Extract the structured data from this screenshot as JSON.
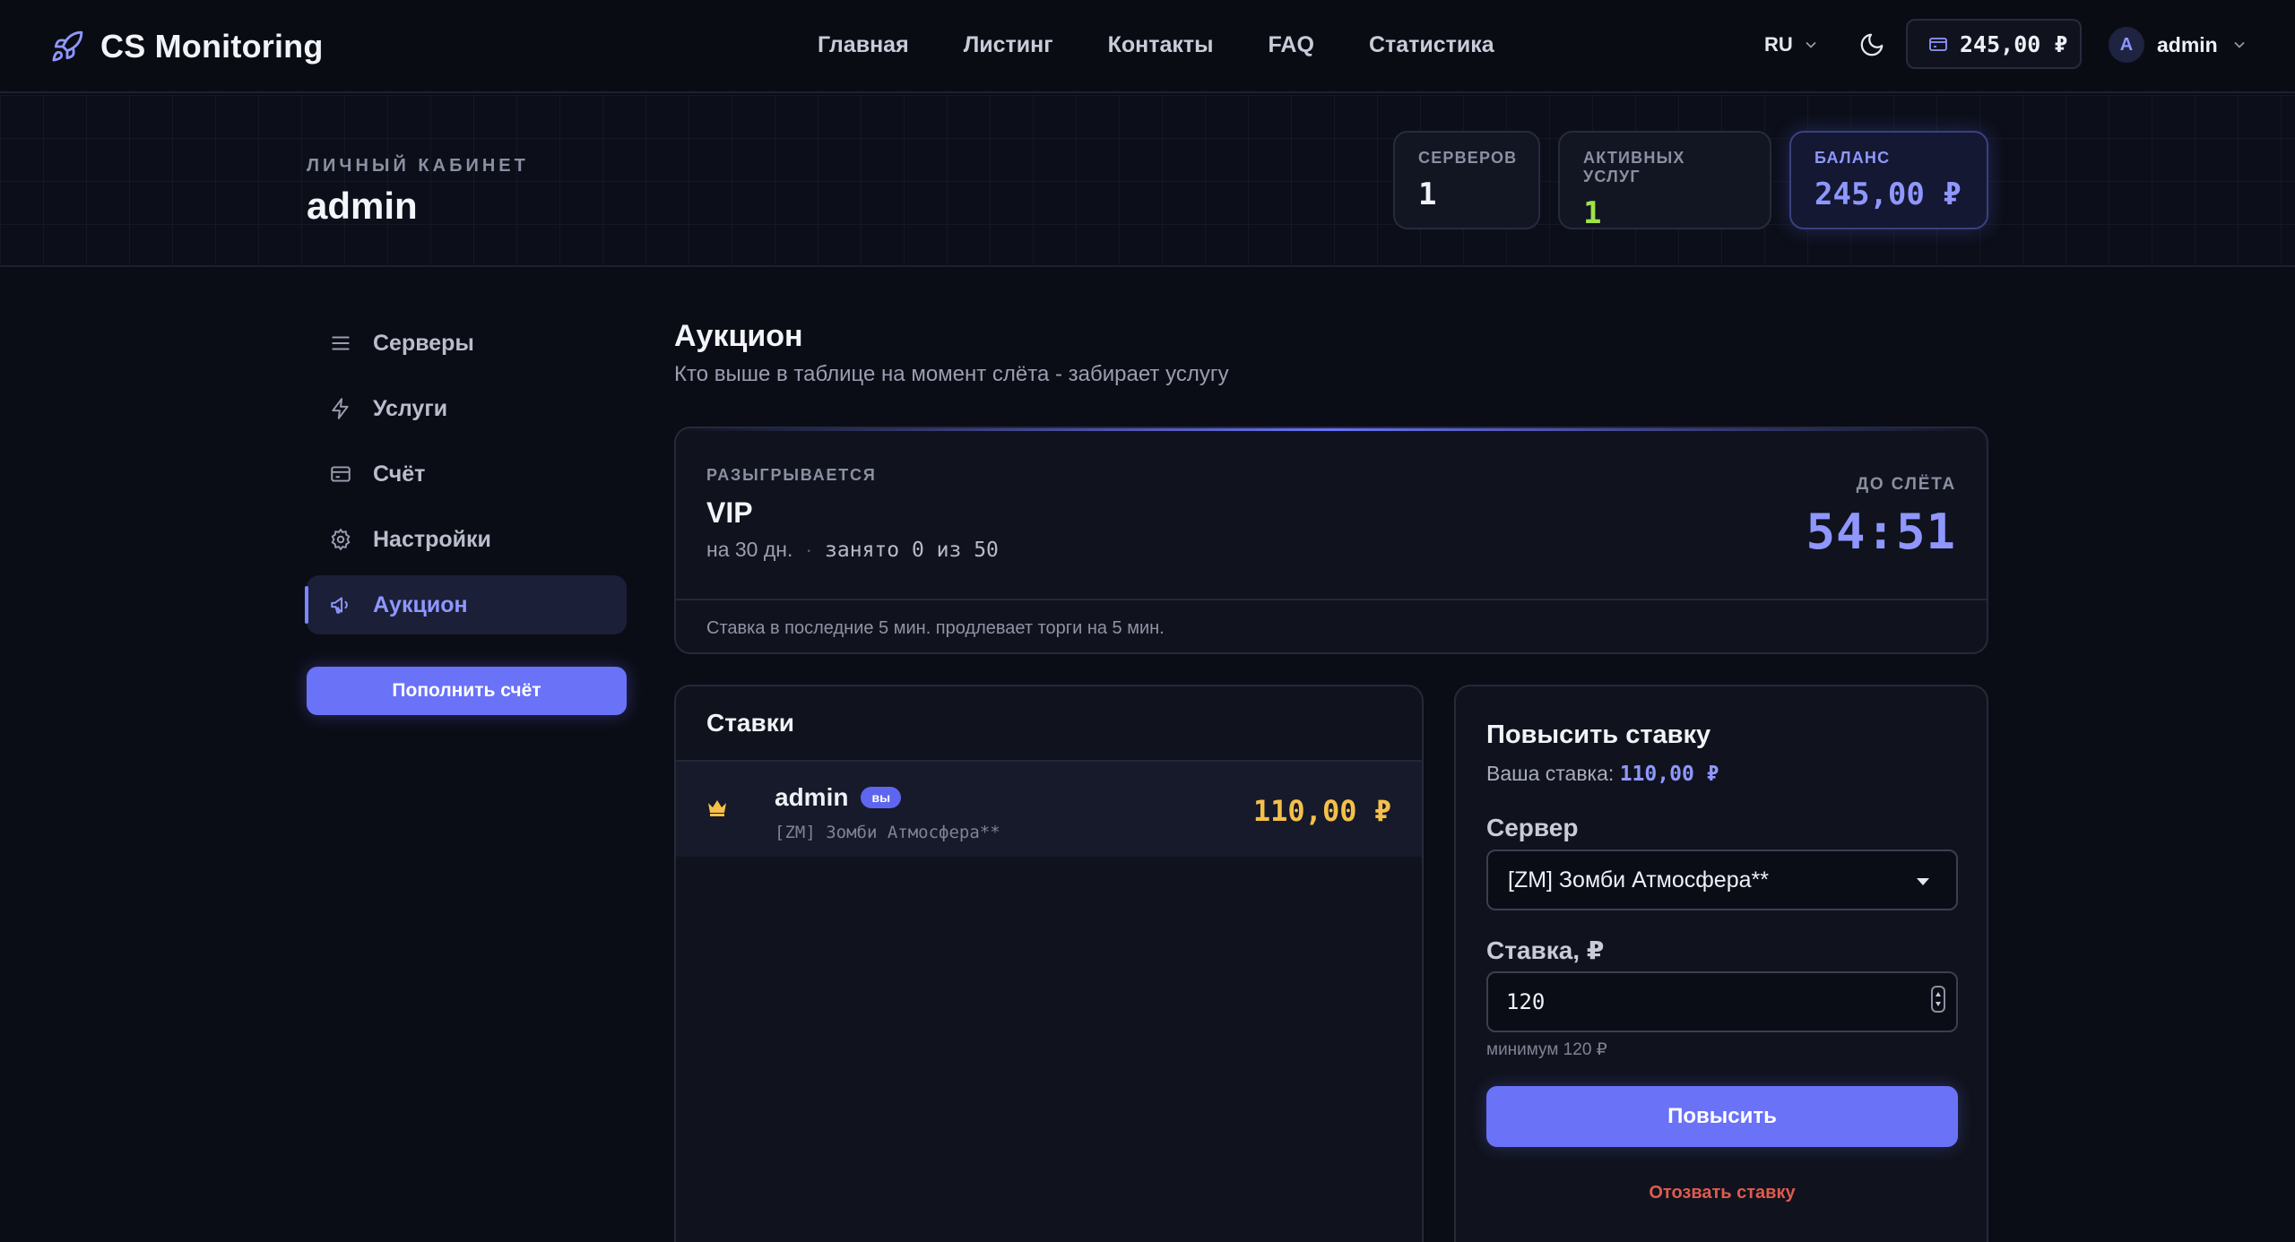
{
  "navbar": {
    "brand": "CS Monitoring",
    "links": [
      "Главная",
      "Листинг",
      "Контакты",
      "FAQ",
      "Статистика"
    ],
    "language": "RU",
    "balance": "245,00 ₽",
    "user_initial": "A",
    "user_name": "admin"
  },
  "header": {
    "section_label": "ЛИЧНЫЙ КАБИНЕТ",
    "user_name": "admin",
    "stats": [
      {
        "label": "СЕРВЕРОВ",
        "value": "1"
      },
      {
        "label": "АКТИВНЫХ УСЛУГ",
        "value": "1"
      },
      {
        "label": "БАЛАНС",
        "value": "245,00 ₽"
      }
    ]
  },
  "sidebar": {
    "items": [
      {
        "label": "Серверы",
        "icon": "list-icon"
      },
      {
        "label": "Услуги",
        "icon": "bolt-icon"
      },
      {
        "label": "Счёт",
        "icon": "card-icon"
      },
      {
        "label": "Настройки",
        "icon": "gear-icon"
      },
      {
        "label": "Аукцион",
        "icon": "megaphone-icon",
        "active": true
      }
    ],
    "topup_label": "Пополнить счёт"
  },
  "main": {
    "title": "Аукцион",
    "subtitle": "Кто выше в таблице на момент слёта - забирает услугу",
    "auction": {
      "lot_label": "РАЗЫГРЫВАЕТСЯ",
      "lot_name": "VIP",
      "duration": "на 30 дн.",
      "occupancy": "занято 0 из 50",
      "deadline_label": "ДО СЛЁТА",
      "timer": "54:51",
      "note": "Ставка в последние 5 мин. продлевает торги на 5 мин."
    },
    "bids": {
      "title": "Ставки",
      "rows": [
        {
          "user": "admin",
          "badge": "вы",
          "server": "[ZM] Зомби Атмосфера**",
          "amount": "110,00 ₽"
        }
      ]
    },
    "raise": {
      "title": "Повысить ставку",
      "your_bid_label": "Ваша ставка:",
      "your_bid_value": "110,00 ₽",
      "server_label": "Сервер",
      "server_selected": "[ZM] Зомби Атмосфера**",
      "amount_label": "Ставка, ₽",
      "amount_value": "120",
      "hint": "минимум 120 ₽",
      "submit_label": "Повысить",
      "withdraw_label": "Отозвать ставку"
    }
  },
  "colors": {
    "accent": "#6a72f8",
    "accent_text": "#8f97ff",
    "gold": "#f5c04a",
    "green": "#9ee34a",
    "danger": "#e05b4f"
  }
}
